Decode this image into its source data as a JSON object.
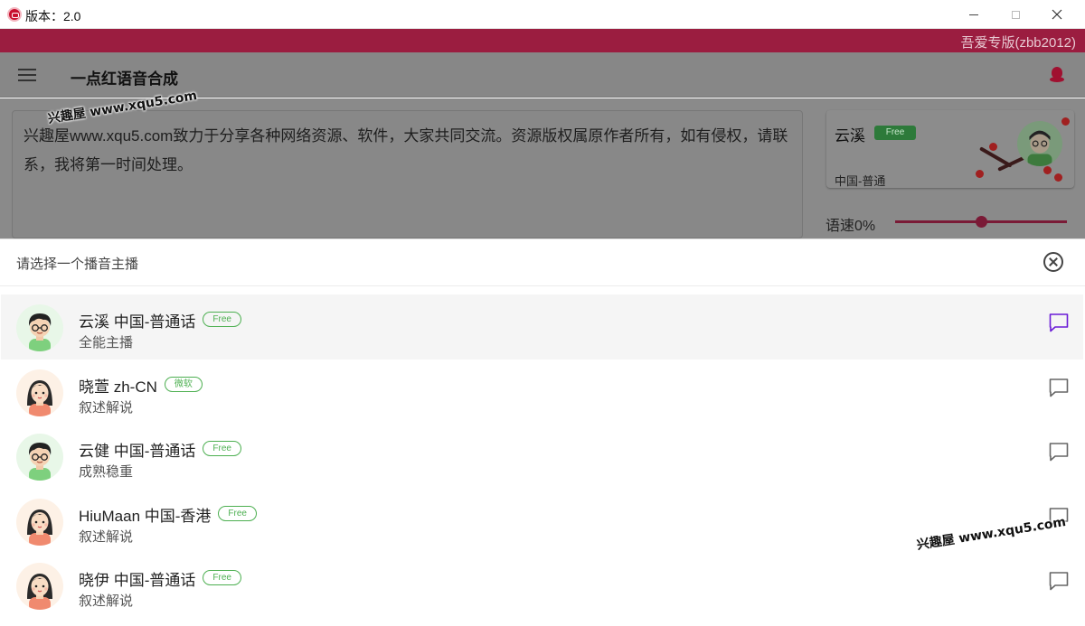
{
  "window": {
    "title": "版本：2.0",
    "banner_text": "吾爱专版(zbb2012)"
  },
  "appbar": {
    "title": "一点红语音合成"
  },
  "editor": {
    "text": "兴趣屋www.xqu5.com致力于分享各种网络资源、软件，大家共同交流。资源版权属原作者所有，如有侵权，请联系，我将第一时间处理。"
  },
  "current_voice": {
    "name": "云溪",
    "badge": "Free",
    "sub": "中国-普通"
  },
  "speed": {
    "label": "语速0%",
    "level": 0.5
  },
  "watermark": "兴趣屋 www.xqu5.com",
  "sheet": {
    "title": "请选择一个播音主播",
    "voices": [
      {
        "name": "云溪 中国-普通话",
        "badge": "Free",
        "desc": "全能主播",
        "gender": "male",
        "selected": true
      },
      {
        "name": "晓萱 zh-CN",
        "badge": "微软",
        "desc": "叙述解说",
        "gender": "female",
        "selected": false
      },
      {
        "name": "云健 中国-普通话",
        "badge": "Free",
        "desc": "成熟稳重",
        "gender": "male",
        "selected": false
      },
      {
        "name": "HiuMaan 中国-香港",
        "badge": "Free",
        "desc": "叙述解说",
        "gender": "female",
        "selected": false
      },
      {
        "name": "晓伊 中国-普通话",
        "badge": "Free",
        "desc": "叙述解说",
        "gender": "female",
        "selected": false
      }
    ]
  },
  "colors": {
    "banner": "#9b1d40",
    "accent": "#c2185b",
    "badge_green": "#4caf50",
    "selected_chat_icon": "#6a1bd6"
  }
}
